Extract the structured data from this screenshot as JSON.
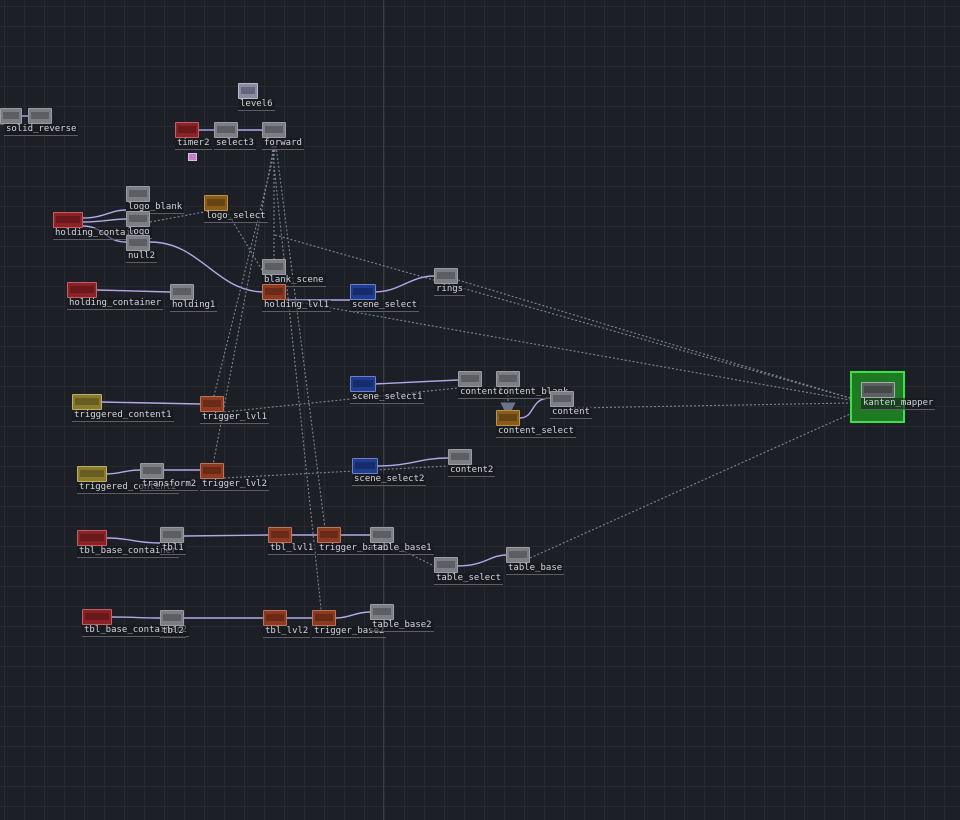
{
  "colors": {
    "background": "#1d1f26",
    "grid": "#262932",
    "wire": "#b3a8e6",
    "reference_link": "#7c8494",
    "selected_outline": "#3ee04a"
  },
  "nodes": [
    {
      "id": "switch_a",
      "label": "",
      "color": "gray",
      "icon": "node-operator-icon"
    },
    {
      "id": "solid_reverse",
      "label": "solid_reverse",
      "color": "gray",
      "icon": "node-operator-icon"
    },
    {
      "id": "level6",
      "label": "level6",
      "color": "lilac",
      "icon": "node-operator-icon"
    },
    {
      "id": "timer2",
      "label": "timer2",
      "color": "red",
      "icon": "node-operator-icon"
    },
    {
      "id": "select3",
      "label": "select3",
      "color": "gray",
      "icon": "node-operator-icon"
    },
    {
      "id": "forward",
      "label": "forward",
      "color": "gray",
      "icon": "node-operator-icon"
    },
    {
      "id": "logo_blank",
      "label": "logo_blank",
      "color": "gray",
      "icon": "node-operator-icon"
    },
    {
      "id": "logo_select",
      "label": "logo_select",
      "color": "amber",
      "icon": "node-operator-icon"
    },
    {
      "id": "holding_contain",
      "label": "holding_contain",
      "color": "red",
      "icon": "node-operator-icon"
    },
    {
      "id": "logo",
      "label": "logo",
      "color": "gray",
      "icon": "node-operator-icon"
    },
    {
      "id": "null2",
      "label": "null2",
      "color": "gray",
      "icon": "node-operator-icon"
    },
    {
      "id": "blank_scene",
      "label": "blank_scene",
      "color": "gray",
      "icon": "node-operator-icon"
    },
    {
      "id": "holding_container",
      "label": "holding_container",
      "color": "red",
      "icon": "node-operator-icon"
    },
    {
      "id": "holding1",
      "label": "holding1",
      "color": "gray",
      "icon": "node-operator-icon"
    },
    {
      "id": "holding_lvl1",
      "label": "holding_lvl1",
      "color": "brown",
      "icon": "node-operator-icon"
    },
    {
      "id": "scene_select",
      "label": "scene_select",
      "color": "blue",
      "icon": "node-operator-icon"
    },
    {
      "id": "rings",
      "label": "rings",
      "color": "gray",
      "icon": "node-operator-icon"
    },
    {
      "id": "scene_select1",
      "label": "scene_select1",
      "color": "blue",
      "icon": "node-operator-icon"
    },
    {
      "id": "content1",
      "label": "content1",
      "color": "gray",
      "icon": "node-operator-icon"
    },
    {
      "id": "content_blank",
      "label": "content_blank",
      "color": "gray",
      "icon": "node-operator-icon"
    },
    {
      "id": "content_select",
      "label": "content_select",
      "color": "amber",
      "icon": "node-operator-icon"
    },
    {
      "id": "content",
      "label": "content",
      "color": "gray",
      "icon": "node-operator-icon"
    },
    {
      "id": "kanten_mapper",
      "label": "kanten_mapper",
      "color": "green",
      "icon": "node-operator-icon"
    },
    {
      "id": "triggered_content1",
      "label": "triggered_content1",
      "color": "olive",
      "icon": "node-operator-icon"
    },
    {
      "id": "trigger_lvl1",
      "label": "trigger_lvl1",
      "color": "brown",
      "icon": "node-operator-icon"
    },
    {
      "id": "triggered_content2",
      "label": "triggered_content2",
      "color": "olive",
      "icon": "node-operator-icon"
    },
    {
      "id": "transform2",
      "label": "transform2",
      "color": "gray",
      "icon": "node-operator-icon"
    },
    {
      "id": "trigger_lvl2",
      "label": "trigger_lvl2",
      "color": "brown",
      "icon": "node-operator-icon"
    },
    {
      "id": "scene_select2",
      "label": "scene_select2",
      "color": "blue",
      "icon": "node-operator-icon"
    },
    {
      "id": "content2",
      "label": "content2",
      "color": "gray",
      "icon": "node-operator-icon"
    },
    {
      "id": "tbl_base_container",
      "label": "tbl_base_container",
      "color": "red",
      "icon": "node-operator-icon"
    },
    {
      "id": "tbl1",
      "label": "tbl1",
      "color": "gray",
      "icon": "node-operator-icon"
    },
    {
      "id": "tbl_lvl1",
      "label": "tbl_lvl1",
      "color": "brown",
      "icon": "node-operator-icon"
    },
    {
      "id": "trigger_base1",
      "label": "trigger_base1",
      "color": "brown",
      "icon": "node-operator-icon"
    },
    {
      "id": "table_base1",
      "label": "table_base1",
      "color": "gray",
      "icon": "node-operator-icon"
    },
    {
      "id": "table_select",
      "label": "table_select",
      "color": "gray",
      "icon": "node-operator-icon"
    },
    {
      "id": "table_base",
      "label": "table_base",
      "color": "gray",
      "icon": "node-operator-icon"
    },
    {
      "id": "tbl_base_container2",
      "label": "tbl_base_container2",
      "color": "red",
      "icon": "node-operator-icon"
    },
    {
      "id": "tbl2",
      "label": "tbl2",
      "color": "gray",
      "icon": "node-operator-icon"
    },
    {
      "id": "tbl_lvl2",
      "label": "tbl_lvl2",
      "color": "brown",
      "icon": "node-operator-icon"
    },
    {
      "id": "trigger_base2",
      "label": "trigger_base2",
      "color": "brown",
      "icon": "node-operator-icon"
    },
    {
      "id": "table_base2",
      "label": "table_base2",
      "color": "gray",
      "icon": "node-operator-icon"
    }
  ]
}
